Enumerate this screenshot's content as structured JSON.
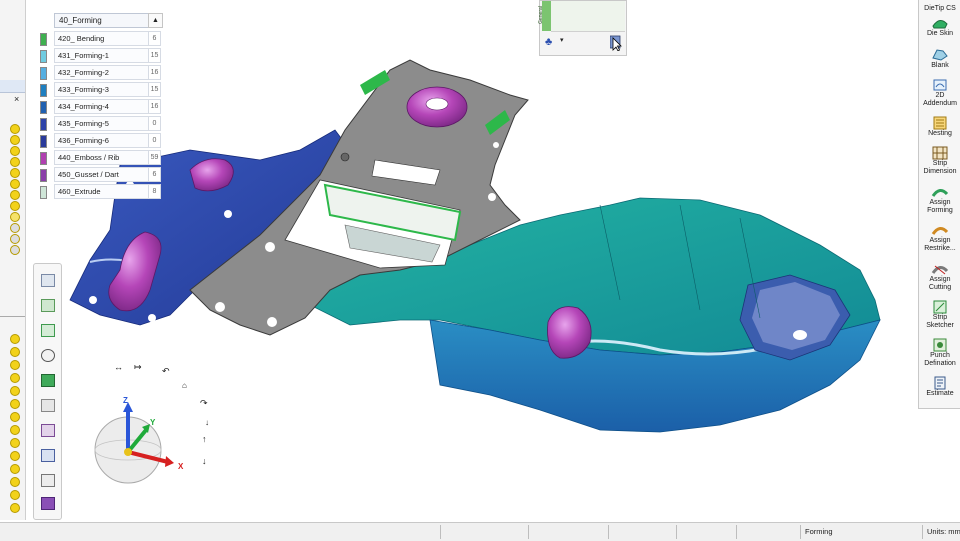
{
  "layers": {
    "header": "40_Forming",
    "items": [
      {
        "name": "420_ Bending",
        "count": "6",
        "color": "#3fb050"
      },
      {
        "name": "431_Forming-1",
        "count": "15",
        "color": "#6fcbe0"
      },
      {
        "name": "432_Forming-2",
        "count": "16",
        "color": "#55aee0"
      },
      {
        "name": "433_Forming-3",
        "count": "15",
        "color": "#1f7fc0"
      },
      {
        "name": "434_Forming-4",
        "count": "16",
        "color": "#2060b0"
      },
      {
        "name": "435_Forming-5",
        "count": "0",
        "color": "#2d43a8"
      },
      {
        "name": "436_Forming-6",
        "count": "0",
        "color": "#2a3a9a"
      },
      {
        "name": "440_Emboss / Rib",
        "count": "59",
        "color": "#b040b0"
      },
      {
        "name": "450_Gusset / Dart",
        "count": "6",
        "color": "#8a3fa8"
      },
      {
        "name": "460_Extrude",
        "count": "8",
        "color": "#cfe6d8"
      }
    ]
  },
  "view_popup": {
    "tab_label": "General"
  },
  "right_toolbar": {
    "header": "DieTip CS",
    "items": [
      {
        "label": "Die Skin",
        "icon": "die-skin-icon"
      },
      {
        "label": "Blank",
        "icon": "blank-icon"
      },
      {
        "label": "2D Addendum",
        "icon": "addendum-icon"
      },
      {
        "label": "Nesting",
        "icon": "nesting-icon"
      },
      {
        "label": "Strip Dimension",
        "icon": "strip-dimension-icon"
      },
      {
        "label": "Assign Forming",
        "icon": "assign-forming-icon"
      },
      {
        "label": "Assign Restrike...",
        "icon": "assign-restrike-icon"
      },
      {
        "label": "Assign Cutting",
        "icon": "assign-cutting-icon"
      },
      {
        "label": "Strip Sketcher",
        "icon": "strip-sketcher-icon"
      },
      {
        "label": "Punch Defination",
        "icon": "punch-definition-icon"
      },
      {
        "label": "Estimate",
        "icon": "estimate-icon"
      }
    ]
  },
  "triad": {
    "x": "X",
    "y": "Y",
    "z": "Z"
  },
  "status_bar": {
    "mode": "Forming",
    "units": "Units: mm"
  },
  "colors": {
    "teal": "#1aa59a",
    "blue": "#2b47a8",
    "gray": "#8a8a8a",
    "magenta": "#a83aa8",
    "green": "#2db84a"
  }
}
